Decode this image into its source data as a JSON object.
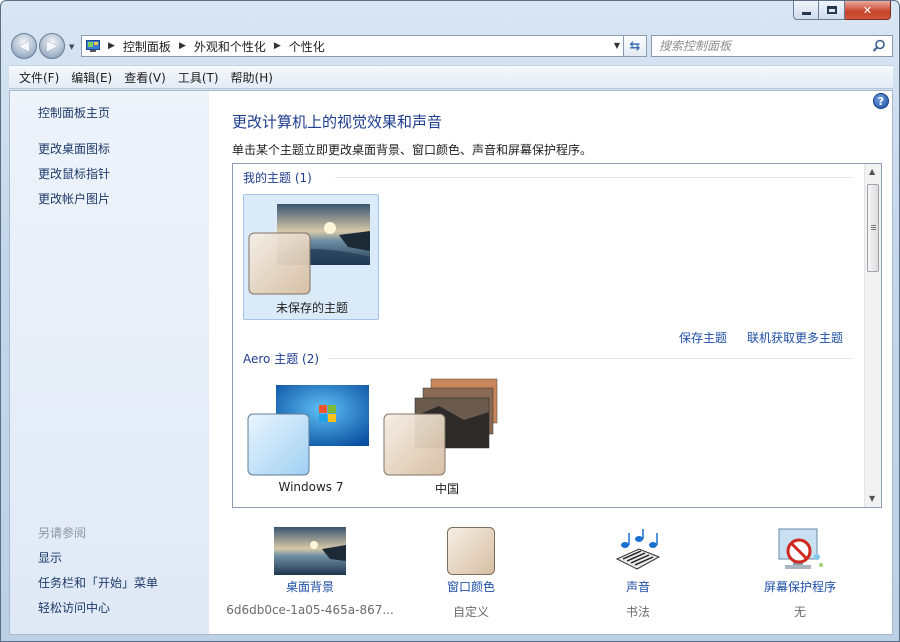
{
  "window": {
    "close_glyph": "✕"
  },
  "address_bar": {
    "breadcrumbs": [
      "控制面板",
      "外观和个性化",
      "个性化"
    ],
    "search_placeholder": "搜索控制面板"
  },
  "menu": [
    "文件(F)",
    "编辑(E)",
    "查看(V)",
    "工具(T)",
    "帮助(H)"
  ],
  "sidebar": {
    "links": [
      "控制面板主页",
      "更改桌面图标",
      "更改鼠标指针",
      "更改帐户图片"
    ],
    "see_also_header": "另请参阅",
    "see_also": [
      "显示",
      "任务栏和「开始」菜单",
      "轻松访问中心"
    ]
  },
  "main": {
    "title": "更改计算机上的视觉效果和声音",
    "description": "单击某个主题立即更改桌面背景、窗口颜色、声音和屏幕保护程序。",
    "my_themes_header": "我的主题 (1)",
    "my_themes": [
      {
        "name": "未保存的主题",
        "selected": true
      }
    ],
    "save_theme_link": "保存主题",
    "get_more_link": "联机获取更多主题",
    "aero_header": "Aero 主题 (2)",
    "aero_themes": [
      {
        "name": "Windows 7"
      },
      {
        "name": "中国"
      }
    ]
  },
  "bottom": {
    "desktop_background": {
      "label": "桌面背景",
      "value": "6d6db0ce-1a05-465a-867..."
    },
    "window_color": {
      "label": "窗口颜色",
      "value": "自定义"
    },
    "sounds": {
      "label": "声音",
      "value": "书法"
    },
    "screensaver": {
      "label": "屏幕保护程序",
      "value": "无"
    }
  },
  "colors": {
    "link": "#1e4fa5",
    "title": "#1e3d8e",
    "selection": "#dbeaf9"
  }
}
